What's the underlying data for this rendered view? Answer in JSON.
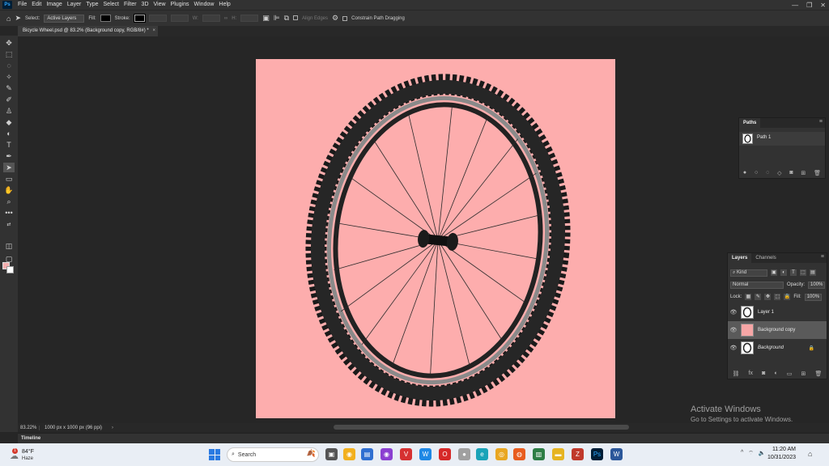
{
  "menubar": {
    "logo": "Ps",
    "items": [
      "File",
      "Edit",
      "Image",
      "Layer",
      "Type",
      "Select",
      "Filter",
      "3D",
      "View",
      "Plugins",
      "Window",
      "Help"
    ],
    "controls": {
      "minimize": "—",
      "restore": "❐",
      "close": "✕"
    }
  },
  "options": {
    "select_label": "Select:",
    "select_value": "Active Layers",
    "fill_label": "Fill:",
    "stroke_label": "Stroke:",
    "w_label": "W:",
    "h_label": "H:",
    "align_edges": "Align Edges",
    "constrain": "Constrain Path Dragging"
  },
  "document": {
    "tab_title": "Bicycle Wheel.psd @ 83.2% (Background copy, RGB/8#) *",
    "close": "×"
  },
  "status": {
    "zoom": "83.22%",
    "dimensions": "1000 px x 1000 px (96 ppi)",
    "arrow": "›"
  },
  "timeline": {
    "label": "Timeline"
  },
  "paths_panel": {
    "tab": "Paths",
    "path_name": "Path 1"
  },
  "layers_panel": {
    "tabs": [
      "Layers",
      "Channels"
    ],
    "filter": "Kind",
    "blend_mode": "Normal",
    "opacity_label": "Opacity:",
    "opacity_value": "100%",
    "lock_label": "Lock:",
    "fill_label": "Fill:",
    "fill_value": "100%",
    "layers": [
      {
        "name": "Layer 1",
        "selected": false,
        "thumb": "#ffffff"
      },
      {
        "name": "Background copy",
        "selected": true,
        "thumb": "#f6a6a6"
      },
      {
        "name": "Background",
        "selected": false,
        "thumb": "#ffffff"
      }
    ]
  },
  "canvas": {
    "background": "#fdadad"
  },
  "watermark": {
    "title": "Activate Windows",
    "subtitle": "Go to Settings to activate Windows."
  },
  "taskbar": {
    "weather_temp": "84°F",
    "weather_desc": "Haze",
    "weather_badge": "1",
    "search_placeholder": "Search",
    "clock_time": "11:20 AM",
    "clock_date": "10/31/2023",
    "tray_chevron": "^"
  }
}
